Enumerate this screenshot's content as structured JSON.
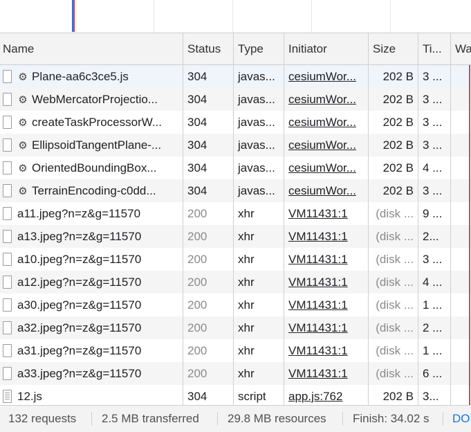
{
  "columns": {
    "name": "Name",
    "status": "Status",
    "type": "Type",
    "initiator": "Initiator",
    "size": "Size",
    "time": "Ti...",
    "waterfall": "Wa"
  },
  "rows": [
    {
      "name": "Plane-aa6c3ce5.js",
      "status": "304",
      "type": "javas...",
      "initiator": "cesiumWor...",
      "size": "202 B",
      "time": "3 ...",
      "icon": "gear-icon",
      "status_color": "#202124"
    },
    {
      "name": "WebMercatorProjectio...",
      "status": "304",
      "type": "javas...",
      "initiator": "cesiumWor...",
      "size": "202 B",
      "time": "3 ...",
      "icon": "gear-icon",
      "status_color": "#202124"
    },
    {
      "name": "createTaskProcessorW...",
      "status": "304",
      "type": "javas...",
      "initiator": "cesiumWor...",
      "size": "202 B",
      "time": "3 ...",
      "icon": "gear-icon",
      "status_color": "#202124"
    },
    {
      "name": "EllipsoidTangentPlane-...",
      "status": "304",
      "type": "javas...",
      "initiator": "cesiumWor...",
      "size": "202 B",
      "time": "3 ...",
      "icon": "gear-icon",
      "status_color": "#202124"
    },
    {
      "name": "OrientedBoundingBox...",
      "status": "304",
      "type": "javas...",
      "initiator": "cesiumWor...",
      "size": "202 B",
      "time": "4 ...",
      "icon": "gear-icon",
      "status_color": "#202124"
    },
    {
      "name": "TerrainEncoding-c0dd...",
      "status": "304",
      "type": "javas...",
      "initiator": "cesiumWor...",
      "size": "202 B",
      "time": "3 ...",
      "icon": "gear-icon",
      "status_color": "#202124"
    },
    {
      "name": "a11.jpeg?n=z&g=11570",
      "status": "200",
      "type": "xhr",
      "initiator": "VM11431:1",
      "size": "(disk ...",
      "time": "9 ...",
      "icon": "file-icon",
      "status_color": "#8a8a8a"
    },
    {
      "name": "a13.jpeg?n=z&g=11570",
      "status": "200",
      "type": "xhr",
      "initiator": "VM11431:1",
      "size": "(disk ...",
      "time": "2...",
      "icon": "file-icon",
      "status_color": "#8a8a8a"
    },
    {
      "name": "a10.jpeg?n=z&g=11570",
      "status": "200",
      "type": "xhr",
      "initiator": "VM11431:1",
      "size": "(disk ...",
      "time": "3 ...",
      "icon": "file-icon",
      "status_color": "#8a8a8a"
    },
    {
      "name": "a12.jpeg?n=z&g=11570",
      "status": "200",
      "type": "xhr",
      "initiator": "VM11431:1",
      "size": "(disk ...",
      "time": "4 ...",
      "icon": "file-icon",
      "status_color": "#8a8a8a"
    },
    {
      "name": "a30.jpeg?n=z&g=11570",
      "status": "200",
      "type": "xhr",
      "initiator": "VM11431:1",
      "size": "(disk ...",
      "time": "1 ...",
      "icon": "file-icon",
      "status_color": "#8a8a8a"
    },
    {
      "name": "a32.jpeg?n=z&g=11570",
      "status": "200",
      "type": "xhr",
      "initiator": "VM11431:1",
      "size": "(disk ...",
      "time": "2 ...",
      "icon": "file-icon",
      "status_color": "#8a8a8a"
    },
    {
      "name": "a31.jpeg?n=z&g=11570",
      "status": "200",
      "type": "xhr",
      "initiator": "VM11431:1",
      "size": "(disk ...",
      "time": "1 ...",
      "icon": "file-icon",
      "status_color": "#8a8a8a"
    },
    {
      "name": "a33.jpeg?n=z&g=11570",
      "status": "200",
      "type": "xhr",
      "initiator": "VM11431:1",
      "size": "(disk ...",
      "time": "6 ...",
      "icon": "file-icon",
      "status_color": "#8a8a8a"
    },
    {
      "name": "12.js",
      "status": "304",
      "type": "script",
      "initiator": "app.js:762",
      "size": "202 B",
      "time": "3...",
      "icon": "script-file-icon",
      "status_color": "#202124"
    }
  ],
  "statusbar": {
    "requests": "132 requests",
    "transferred": "2.5 MB transferred",
    "resources": "29.8 MB resources",
    "finish": "Finish: 34.02 s",
    "domcontent": "DO"
  },
  "colors": {
    "accent_link": "#1a73e8",
    "waterfall_red": "#d14b4b",
    "overview_blue": "#3b6fd8",
    "overview_red": "#d14b4b"
  }
}
